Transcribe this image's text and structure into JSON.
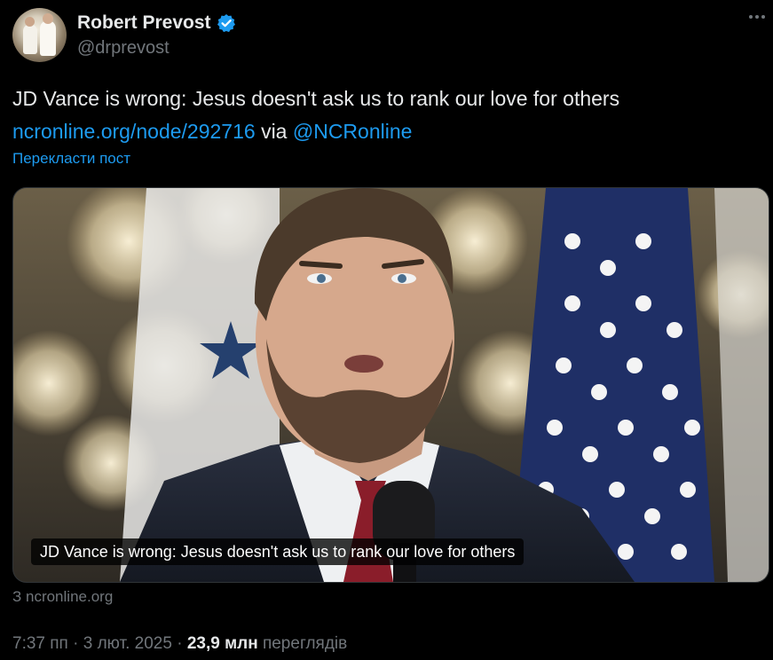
{
  "author": {
    "name": "Robert Prevost",
    "handle": "@drprevost",
    "verified": true
  },
  "tweet": {
    "text": "JD Vance is wrong: Jesus doesn't ask us to rank our love for others",
    "link_text": "ncronline.org/node/292716",
    "via_text": "via",
    "mention_text": "@NCRonline",
    "translate_label": "Перекласти пост"
  },
  "card": {
    "caption": "JD Vance is wrong: Jesus doesn't ask us to rank our love for others",
    "source": "З ncronline.org"
  },
  "meta": {
    "time": "7:37 пп",
    "date": "3 лют. 2025",
    "views_count": "23,9 млн",
    "views_label": "переглядів",
    "separator": "·"
  },
  "colors": {
    "background": "#000000",
    "text_primary": "#e7e9ea",
    "text_secondary": "#71767b",
    "accent": "#1d9bf0"
  },
  "icons": [
    "verified-badge-icon",
    "more-options-icon"
  ]
}
